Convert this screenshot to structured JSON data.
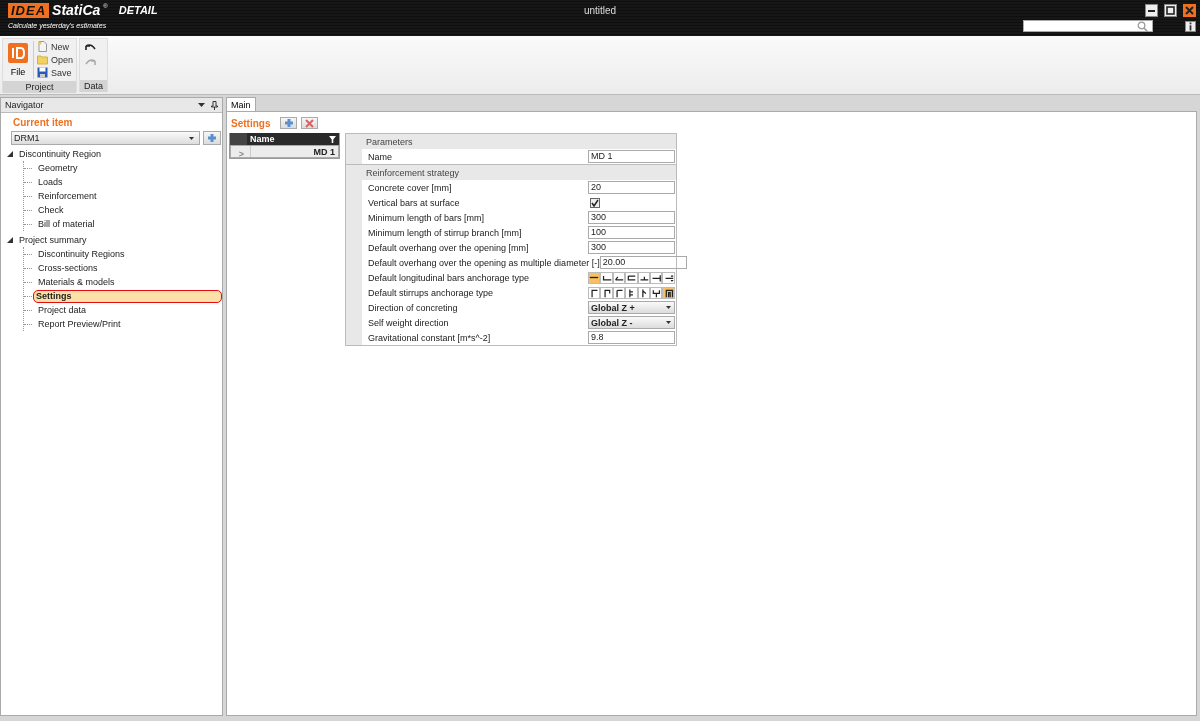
{
  "app": {
    "logo": "IDEA",
    "brand": "StatiCa",
    "reg": "®",
    "product": "DETAIL",
    "tagline": "Calculate yesterday's estimates",
    "title": "untitled"
  },
  "ribbon": {
    "groups": [
      {
        "label": "Project",
        "file": "File",
        "items": [
          {
            "kind": "new",
            "label": "New"
          },
          {
            "kind": "open",
            "label": "Open"
          },
          {
            "kind": "save",
            "label": "Save"
          }
        ]
      },
      {
        "label": "Data",
        "items": [
          {
            "kind": "undo",
            "disabled": false
          },
          {
            "kind": "redo",
            "disabled": true
          }
        ]
      }
    ]
  },
  "navigator": {
    "title": "Navigator",
    "current_item": "Current item",
    "dropdown": "DRM1",
    "tree": [
      {
        "label": "Discontinuity Region",
        "expanded": true,
        "children": [
          {
            "label": "Geometry",
            "selected": false
          },
          {
            "label": "Loads",
            "selected": false
          },
          {
            "label": "Reinforcement",
            "selected": false
          },
          {
            "label": "Check",
            "selected": false
          },
          {
            "label": "Bill of material",
            "selected": false
          }
        ]
      },
      {
        "label": "Project summary",
        "expanded": true,
        "children": [
          {
            "label": "Discontinuity Regions",
            "selected": false
          },
          {
            "label": "Cross-sections",
            "selected": false
          },
          {
            "label": "Materials & models",
            "selected": false
          },
          {
            "label": "Settings",
            "selected": true
          },
          {
            "label": "Project data",
            "selected": false
          },
          {
            "label": "Report Preview/Print",
            "selected": false
          }
        ]
      }
    ]
  },
  "tabs": [
    {
      "label": "Main",
      "selected": true
    }
  ],
  "settings": {
    "title": "Settings",
    "list": {
      "column": "Name",
      "rows": [
        {
          "indicator": ">",
          "name": "MD 1",
          "selected": true
        }
      ]
    },
    "sections": [
      {
        "title": "Parameters",
        "rows": [
          {
            "kind": "text",
            "label": "Name",
            "value": "MD 1"
          }
        ]
      },
      {
        "title": "Reinforcement strategy",
        "rows": [
          {
            "kind": "text",
            "label": "Concrete cover [mm]",
            "value": "20"
          },
          {
            "kind": "checkbox",
            "label": "Vertical bars at surface",
            "checked": true
          },
          {
            "kind": "text",
            "label": "Minimum length of bars [mm]",
            "value": "300"
          },
          {
            "kind": "text",
            "label": "Minimum length of stirrup branch [mm]",
            "value": "100"
          },
          {
            "kind": "text",
            "label": "Default overhang over the opening [mm]",
            "value": "300"
          },
          {
            "kind": "text",
            "label": "Default overhang over the opening as multiple diameter [-]",
            "value": "20.00"
          },
          {
            "kind": "bars",
            "label": "Default longitudinal bars anchorage type",
            "options": [
              {
                "selected": true
              },
              {
                "selected": false
              },
              {
                "selected": false
              },
              {
                "selected": false
              },
              {
                "selected": false
              },
              {
                "selected": false
              },
              {
                "selected": false
              }
            ]
          },
          {
            "kind": "stirrups",
            "label": "Default stirrups anchorage type",
            "options": [
              {
                "selected": false
              },
              {
                "selected": false
              },
              {
                "selected": false
              },
              {
                "selected": false
              },
              {
                "selected": false
              },
              {
                "selected": false
              },
              {
                "selected": true
              }
            ]
          },
          {
            "kind": "select",
            "label": "Direction of concreting",
            "value": "Global Z +"
          },
          {
            "kind": "select",
            "label": "Self weight direction",
            "value": "Global Z -"
          },
          {
            "kind": "text",
            "label": "Gravitational constant [m*s^-2]",
            "value": "9.8"
          }
        ]
      }
    ]
  }
}
